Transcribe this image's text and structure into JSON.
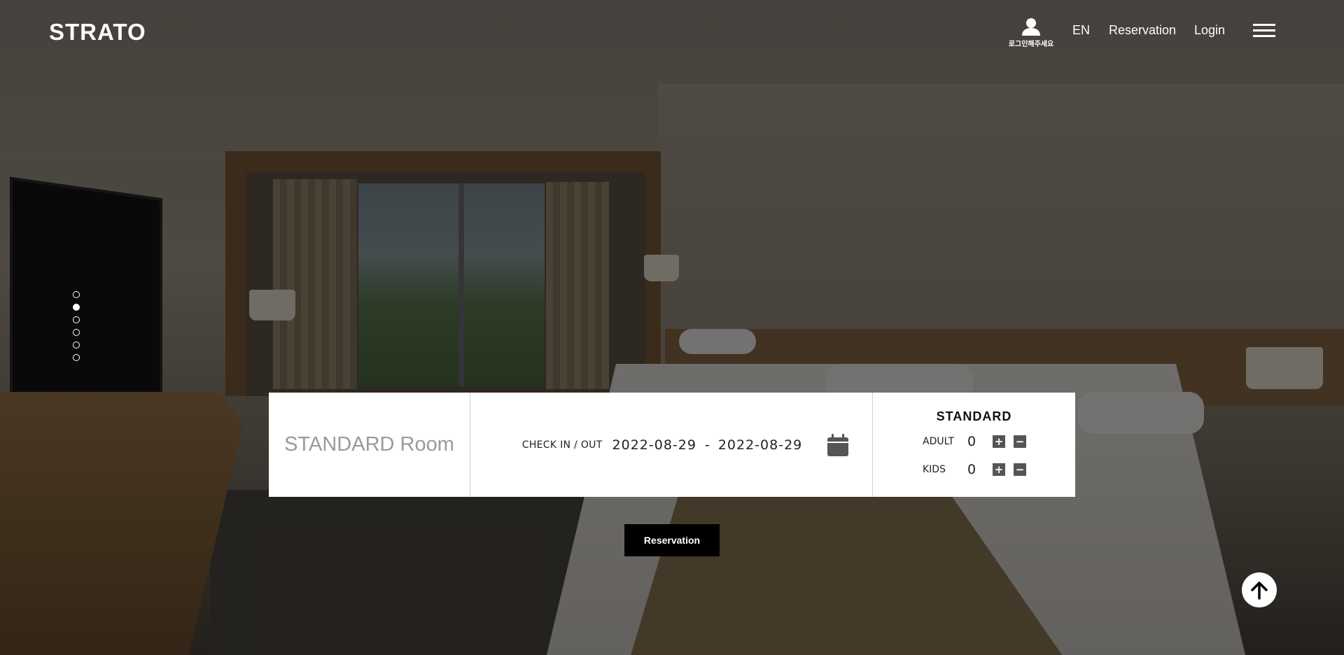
{
  "header": {
    "logo": "STRATO",
    "user_hint": "로그인해주세요",
    "lang": "EN",
    "nav_reservation": "Reservation",
    "nav_login": "Login",
    "user_icon": "user-icon",
    "menu_icon": "hamburger-menu-icon"
  },
  "slider": {
    "dot_count": 6,
    "active_index": 1
  },
  "booking": {
    "room_name": "STANDARD Room",
    "checkin_label": "CHECK IN / OUT",
    "checkin_date": "2022-08-29",
    "separator": "-",
    "checkout_date": "2022-08-29",
    "calendar_icon": "calendar-icon",
    "room_type": "STANDARD",
    "adult_label": "ADULT",
    "adult_count": "0",
    "kids_label": "KIDS",
    "kids_count": "0",
    "plus": "+",
    "minus": "−"
  },
  "actions": {
    "reservation_button": "Reservation",
    "scroll_top_icon": "arrow-up-icon"
  }
}
